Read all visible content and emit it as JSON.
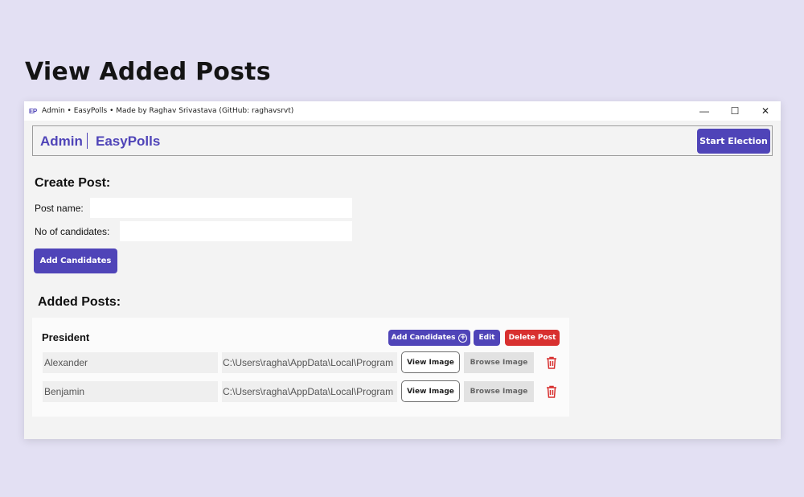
{
  "page": {
    "heading": "View Added Posts"
  },
  "window": {
    "logo": "EP",
    "title": "Admin  •  EasyPolls  •  Made by Raghav Srivastava (GitHub: raghavsrvt)",
    "controls": {
      "minimize": "—",
      "maximize": "☐",
      "close": "✕"
    }
  },
  "header": {
    "admin": "Admin",
    "app_name": "EasyPolls",
    "start_election": "Start Election"
  },
  "create_post": {
    "title": "Create Post:",
    "post_name_label": "Post name:",
    "post_name_value": "",
    "candidates_label": "No of candidates:",
    "candidates_value": "",
    "add_candidates": "Add Candidates"
  },
  "added_posts": {
    "title": "Added Posts:",
    "posts": [
      {
        "name": "President",
        "add_candidates": "Add Candidates",
        "edit": "Edit",
        "delete": "Delete Post",
        "candidates": [
          {
            "name": "Alexander",
            "image_path": "C:\\Users\\ragha\\AppData\\Local\\Program",
            "view": "View Image",
            "browse": "Browse Image"
          },
          {
            "name": "Benjamin",
            "image_path": "C:\\Users\\ragha\\AppData\\Local\\Program",
            "view": "View Image",
            "browse": "Browse Image"
          }
        ]
      }
    ]
  },
  "colors": {
    "accent": "#4f44b8",
    "danger": "#d8302f",
    "page_bg": "#e3e0f3",
    "window_bg": "#f3f3f3"
  },
  "icons": {
    "trash": "trash-icon",
    "plus": "plus-circle-icon"
  }
}
